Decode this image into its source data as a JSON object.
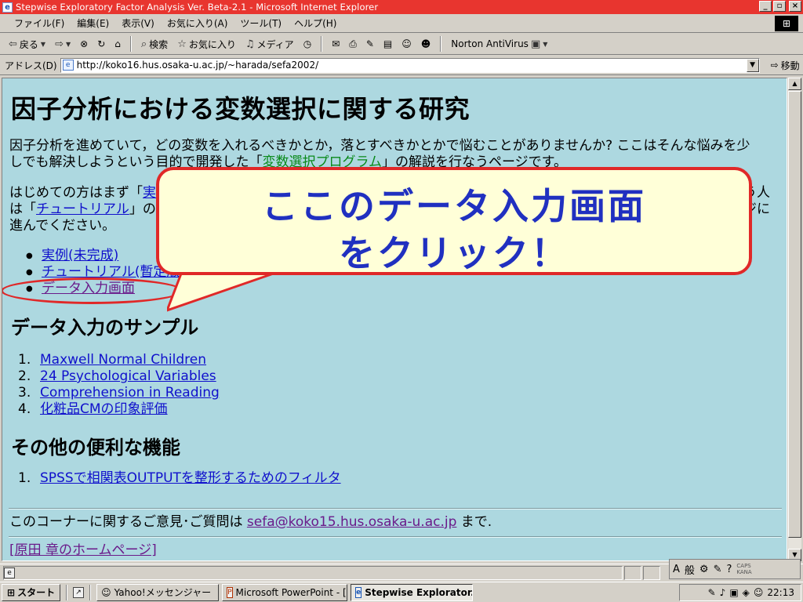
{
  "window": {
    "title": "Stepwise Exploratory Factor Analysis Ver. Beta-2.1 - Microsoft Internet Explorer",
    "controls": [
      "_",
      "▫",
      "×"
    ]
  },
  "menu": [
    "ファイル(F)",
    "編集(E)",
    "表示(V)",
    "お気に入り(A)",
    "ツール(T)",
    "ヘルプ(H)"
  ],
  "toolbar": {
    "back": "戻る",
    "search": "検索",
    "favorites": "お気に入り",
    "media": "メディア",
    "norton": "Norton AntiVirus"
  },
  "address": {
    "label": "アドレス(D)",
    "url": "http://koko16.hus.osaka-u.ac.jp/~harada/sefa2002/",
    "go": "移動"
  },
  "page": {
    "title": "因子分析における変数選択に関する研究",
    "intro_1": "因子分析を進めていて，どの変数を入れるべきかとか，落とすべきかとかで悩むことがありませんか? ここはそんな悩みを少",
    "intro_2a": "しでも解決しようという目的で開発した「",
    "intro_2_link": "変数選択プログラム",
    "intro_2b": "」の解説を行なうページです。",
    "guide_1a": "はじめての方はまず「",
    "guide_1_link": "実",
    "guide_1_tail": "う人",
    "guide_2a": "は「",
    "guide_2_link": "チュートリアル",
    "guide_2b": "」のペ",
    "guide_2_tail": "ジに",
    "guide_3": "進んでください。",
    "links": [
      "実例(未完成)",
      "チュートリアル(暫定版)",
      "データ入力画面"
    ],
    "samples_heading": "データ入力のサンプル",
    "samples": [
      {
        "num": "1.",
        "label": "Maxwell Normal Children"
      },
      {
        "num": "2.",
        "label": "24 Psychological Variables"
      },
      {
        "num": "3.",
        "label": "Comprehension in Reading"
      },
      {
        "num": "4.",
        "label": "化粧品CMの印象評価"
      }
    ],
    "tools_heading": "その他の便利な機能",
    "tools": [
      {
        "num": "1.",
        "label": "SPSSで相関表OUTPUTを整形するためのフィルタ"
      }
    ],
    "contact_prefix": "このコーナーに関するご意見･ご質問は",
    "contact_email": "sefa@koko15.hus.osaka-u.ac.jp",
    "contact_suffix": "まで.",
    "home_link": "[原田 章のホームページ]"
  },
  "callout": {
    "line1": "ここのデータ入力画面",
    "line2": "をクリック！"
  },
  "ime": {
    "mode": "般",
    "caps": "CAPS",
    "kana": "KANA"
  },
  "taskbar": {
    "start": "スタート",
    "tasks": [
      {
        "label": "Yahoo!メッセンジャー",
        "active": false
      },
      {
        "label": "Microsoft PowerPoint - [..",
        "active": false
      },
      {
        "label": "Stepwise Explorator...",
        "active": true
      }
    ],
    "clock": "22:13"
  },
  "colors": {
    "titlebar": "#e8352f",
    "page_bg": "#add8e0",
    "link": "#1010cc",
    "callout_border": "#e02828",
    "callout_text": "#2030c0"
  }
}
